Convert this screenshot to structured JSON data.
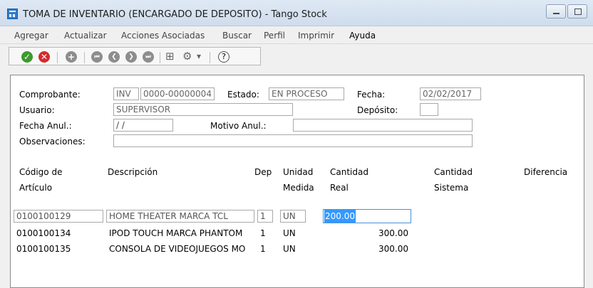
{
  "window": {
    "title": "TOMA DE INVENTARIO (ENCARGADO DE DEPOSITO) - Tango Stock"
  },
  "menu": [
    {
      "label": "Agregar"
    },
    {
      "label": "Actualizar"
    },
    {
      "label": "Acciones Asociadas"
    },
    {
      "label": "Buscar"
    },
    {
      "label": "Perfil"
    },
    {
      "label": "Imprimir"
    },
    {
      "label": "Ayuda"
    }
  ],
  "toolbar": {
    "icons": [
      "accept-icon",
      "cancel-icon",
      "add-icon",
      "first-icon",
      "previous-icon",
      "next-icon",
      "last-icon",
      "binoculars-icon",
      "settings-icon",
      "dropdown-icon",
      "help-icon"
    ],
    "accept_glyph": "✓",
    "cancel_glyph": "✕",
    "add_glyph": "+",
    "first_glyph": "⏮",
    "prev_glyph": "❮",
    "next_glyph": "❯",
    "last_glyph": "⏭",
    "binoculars_glyph": "⊞",
    "settings_glyph": "⚙",
    "dropdown_glyph": "▾",
    "help_glyph": "?"
  },
  "header": {
    "comprobante_label": "Comprobante:",
    "comprobante_type": "INV",
    "comprobante_number": "0000-00000004",
    "estado_label": "Estado:",
    "estado_value": "EN PROCESO",
    "fecha_label": "Fecha:",
    "fecha_value": "02/02/2017",
    "usuario_label": "Usuario:",
    "usuario_value": "SUPERVISOR",
    "deposito_label": "Depósito:",
    "deposito_value": "",
    "fecha_anul_label": "Fecha Anul.:",
    "fecha_anul_value": " / /",
    "motivo_anul_label": "Motivo Anul.:",
    "motivo_anul_value": "",
    "observaciones_label": "Observaciones:",
    "observaciones_value": ""
  },
  "grid": {
    "headers": {
      "codigo_1": "Código de",
      "codigo_2": "Artículo",
      "descripcion": "Descripción",
      "dep": "Dep",
      "unidad_1": "Unidad",
      "unidad_2": "Medida",
      "cant_real_1": "Cantidad",
      "cant_real_2": "Real",
      "cant_sist_1": "Cantidad",
      "cant_sist_2": "Sistema",
      "diferencia": "Diferencia"
    },
    "rows": [
      {
        "codigo": "0100100129",
        "descripcion": "HOME THEATER MARCA TCL",
        "dep": "1",
        "unidad": "UN",
        "cantidad_real": "200.00"
      },
      {
        "codigo": "0100100134",
        "descripcion": "IPOD TOUCH MARCA PHANTOM",
        "dep": "1",
        "unidad": "UN",
        "cantidad_real": "300.00"
      },
      {
        "codigo": "0100100135",
        "descripcion": "CONSOLA DE VIDEOJUEGOS MO",
        "dep": "1",
        "unidad": "UN",
        "cantidad_real": "300.00"
      }
    ]
  }
}
